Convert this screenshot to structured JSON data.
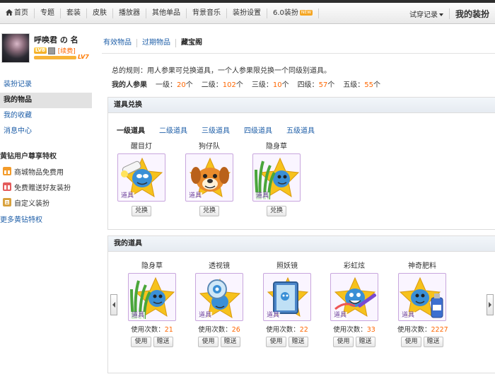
{
  "topnav": {
    "home": "首页",
    "items": [
      "专题",
      "套装",
      "皮肤",
      "播放器",
      "其他单品",
      "背景音乐",
      "装扮设置",
      "6.0装扮"
    ],
    "new_badge": "NEW",
    "trial": "试穿记录",
    "my_dress": "我的装扮"
  },
  "profile": {
    "username": "呼唤君 の 名",
    "vip_level": "LV8",
    "renew": "[续费]",
    "level": "LV7"
  },
  "sidebar": {
    "items": [
      "装扮记录",
      "我的物品",
      "我的收藏",
      "消息中心"
    ],
    "vip_title": "黄钻用户尊享特权",
    "vip_items": [
      "商城物品免费用",
      "免费赠送好友装扮",
      "自定义装扮"
    ],
    "more": "更多黄钻特权"
  },
  "main": {
    "tabs": [
      "有效物品",
      "过期物品",
      "藏宝阁"
    ],
    "rules": "总的规则：用人参果可兑换道具，一个人参果限兑换一个同级别道具。",
    "tickets_label": "我的人参果",
    "tickets": [
      {
        "label": "一级：",
        "count": "20",
        "unit": "个"
      },
      {
        "label": "二级：",
        "count": "102",
        "unit": "个"
      },
      {
        "label": "三级：",
        "count": "10",
        "unit": "个"
      },
      {
        "label": "四级：",
        "count": "57",
        "unit": "个"
      },
      {
        "label": "五级：",
        "count": "55",
        "unit": "个"
      }
    ]
  },
  "exchange": {
    "title": "道具兑换",
    "level_tabs": [
      "一级道具",
      "二级道具",
      "三级道具",
      "四级道具",
      "五级道具"
    ],
    "items": [
      {
        "name": "醒目灯",
        "tag": "道具",
        "button": "兑换"
      },
      {
        "name": "狗仔队",
        "tag": "道具",
        "button": "兑换"
      },
      {
        "name": "隐身草",
        "tag": "道具",
        "button": "兑换"
      }
    ]
  },
  "my_items": {
    "title": "我的道具",
    "uses_label": "使用次数：",
    "use_btn": "使用",
    "gift_btn": "赠送",
    "items": [
      {
        "name": "隐身草",
        "tag": "道具",
        "uses": "21"
      },
      {
        "name": "透视镜",
        "tag": "道具",
        "uses": "26"
      },
      {
        "name": "照妖镜",
        "tag": "道具",
        "uses": "22"
      },
      {
        "name": "彩虹炫",
        "tag": "道具",
        "uses": "33"
      },
      {
        "name": "神奇肥料",
        "tag": "道具",
        "uses": "2227"
      }
    ]
  },
  "colors": {
    "link": "#1f5fa8",
    "accent": "#ff6600",
    "item_border": "#c8a6dd"
  }
}
